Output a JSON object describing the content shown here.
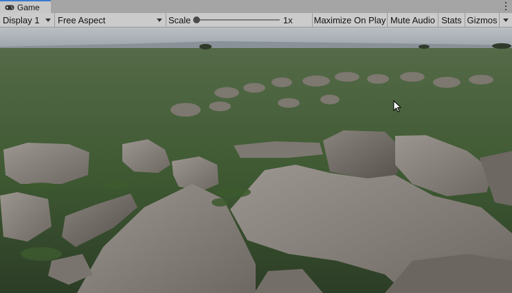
{
  "tab": {
    "icon": "gamepad-icon",
    "label": "Game",
    "menu_icon": "kebab-menu-icon"
  },
  "toolbar": {
    "display": {
      "selected": "Display 1",
      "icon": "chevron-down-icon"
    },
    "aspect": {
      "selected": "Free Aspect",
      "icon": "chevron-down-icon"
    },
    "scale": {
      "label": "Scale",
      "value": "1x"
    },
    "maximize_label": "Maximize On Play",
    "mute_label": "Mute Audio",
    "stats_label": "Stats",
    "gizmos": {
      "label": "Gizmos",
      "icon": "chevron-down-icon"
    }
  },
  "viewport": {
    "content": "game-view-render",
    "cursor": "mouse-pointer-icon"
  },
  "colors": {
    "accent": "#3a79d1",
    "toolbar": "#cbcbcb",
    "tabbar": "#a5a5a5"
  }
}
